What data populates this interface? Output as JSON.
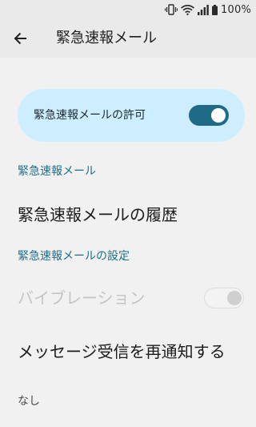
{
  "status_bar": {
    "battery_percent": "100%",
    "icons": [
      "vibrate-icon",
      "wifi-icon",
      "signal-icon",
      "battery-icon"
    ]
  },
  "app_bar": {
    "back_icon": "arrow-back-icon",
    "title": "緊急速報メール"
  },
  "master_switch": {
    "label": "緊急速報メールの許可",
    "checked": true
  },
  "sections": {
    "alerts_header": "緊急速報メール",
    "history_title": "緊急速報メールの履歴",
    "settings_header": "緊急速報メールの設定"
  },
  "preferences": {
    "vibration": {
      "title": "バイブレーション",
      "enabled": false,
      "checked": false
    },
    "reminder": {
      "title": "メッセージ受信を再通知する",
      "summary": "なし"
    }
  },
  "colors": {
    "accent": "#1f6a86",
    "section_header": "#1f6f8b",
    "card_background": "#cdeeff",
    "page_background": "#f1f1f1",
    "app_bar_background": "#eaeaea"
  }
}
